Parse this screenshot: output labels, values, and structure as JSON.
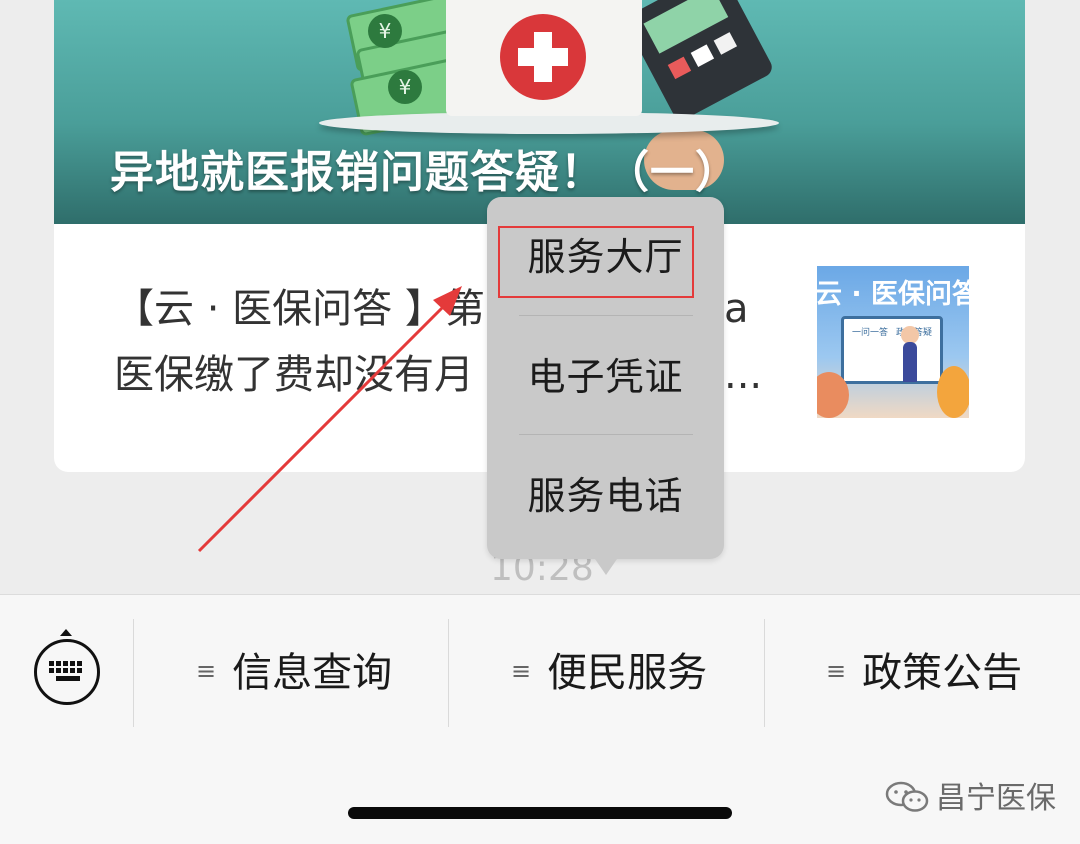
{
  "article_card": {
    "banner_title": "异地就医报销问题答疑！（一）",
    "desc_line1": "【云 · 医保问答 】第",
    "desc_line1_end": "a",
    "desc_line2": "医保缴了费却没有",
    "desc_line2_end": "月",
    "desc_ellipsis": "...",
    "thumbnail_title": "云 · 医保问答",
    "thumbnail_board_left": "一问一答",
    "thumbnail_board_right": "政策答疑",
    "currency_symbol": "¥"
  },
  "popup_menu": {
    "items": [
      {
        "label": "服务大厅",
        "highlighted": true
      },
      {
        "label": "电子凭证",
        "highlighted": false
      },
      {
        "label": "服务电话",
        "highlighted": false
      }
    ]
  },
  "timestamp": "10:28",
  "bottom_menu": {
    "keyboard_icon": "keyboard-icon",
    "tabs": [
      {
        "label": "信息查询",
        "icon": "menu-lines-icon"
      },
      {
        "label": "便民服务",
        "icon": "menu-lines-icon"
      },
      {
        "label": "政策公告",
        "icon": "menu-lines-icon"
      }
    ]
  },
  "watermark": {
    "account_name": "昌宁医保",
    "icon": "wechat-icon"
  },
  "colors": {
    "highlight_border": "#e43a3a",
    "arrow": "#e43a3a",
    "popup_bg": "#c9c9c9"
  }
}
